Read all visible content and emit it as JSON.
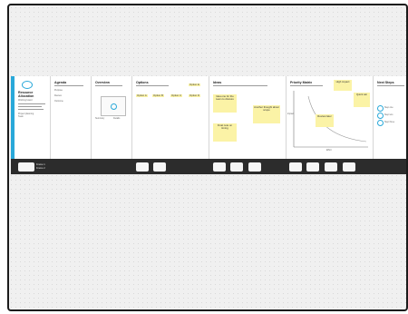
{
  "colors": {
    "accent": "#29a8d9",
    "sticky": "#fbf3a6",
    "bar": "#2c2c2c",
    "canvas": "#f0f0f0"
  },
  "slides": [
    {
      "title": "Resource Allocation",
      "subtitle": "Working board",
      "lines": [
        "Project planning",
        "Team"
      ]
    },
    {
      "title": "Agenda",
      "lines": [
        "Purpose",
        "Review",
        "Outcome"
      ]
    },
    {
      "title": "Overview",
      "lines": [
        "Summary",
        "Details"
      ]
    },
    {
      "title": "Options",
      "labels": [
        "Option A",
        "Option B",
        "Option C",
        "Option D",
        "Option E"
      ]
    },
    {
      "title": "Ideas",
      "notes": [
        "Idea one for the team to discuss",
        "Another thought about scope",
        "Final note on timing"
      ]
    },
    {
      "title": "Priority Matrix",
      "xlabel": "Effort",
      "ylabel": "Impact",
      "notes": [
        "High impact",
        "Quick win",
        "Review later"
      ]
    },
    {
      "title": "Next Steps",
      "items": [
        "Step one",
        "Step two",
        "Step three"
      ]
    }
  ],
  "bar": {
    "labels": [
      "Frame 1",
      "Frame 2"
    ]
  }
}
